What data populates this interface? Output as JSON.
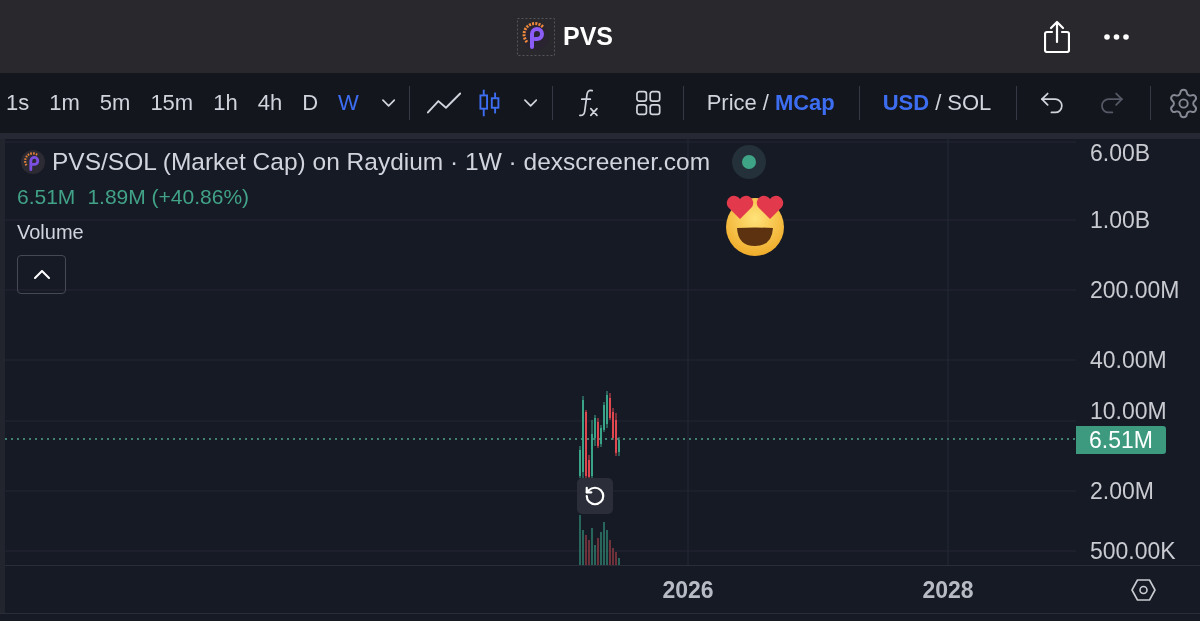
{
  "header": {
    "title": "PVS"
  },
  "toolbar": {
    "timeframes": [
      {
        "label": "1s",
        "selected": false
      },
      {
        "label": "1m",
        "selected": false
      },
      {
        "label": "5m",
        "selected": false
      },
      {
        "label": "15m",
        "selected": false
      },
      {
        "label": "1h",
        "selected": false
      },
      {
        "label": "4h",
        "selected": false
      },
      {
        "label": "D",
        "selected": false
      },
      {
        "label": "W",
        "selected": true
      }
    ],
    "chart_types": [
      {
        "kind": "line",
        "selected": false
      },
      {
        "kind": "candles",
        "selected": true
      }
    ],
    "value_mode": {
      "options": [
        {
          "label": "Price",
          "selected": false
        },
        {
          "label": "MCap",
          "selected": true
        }
      ],
      "separator": "/"
    },
    "currency": {
      "options": [
        {
          "label": "USD",
          "selected": true
        },
        {
          "label": "SOL",
          "selected": false
        }
      ],
      "separator": "/"
    },
    "history": [
      {
        "kind": "undo",
        "disabled": false
      },
      {
        "kind": "redo",
        "disabled": true
      }
    ]
  },
  "legend": {
    "title": "PVS/SOL (Market Cap) on Raydium · 1W · dexscreener.com",
    "value": "6.51M",
    "change": "1.89M (+40.86%)",
    "indicator": "Volume"
  },
  "price_axis": {
    "ticks": [
      "6.00B",
      "1.00B",
      "200.00M",
      "40.00M",
      "10.00M",
      "2.00M",
      "500.00K"
    ],
    "last_price": "6.51M"
  },
  "time_axis": {
    "ticks": [
      "2026",
      "2028"
    ]
  }
}
